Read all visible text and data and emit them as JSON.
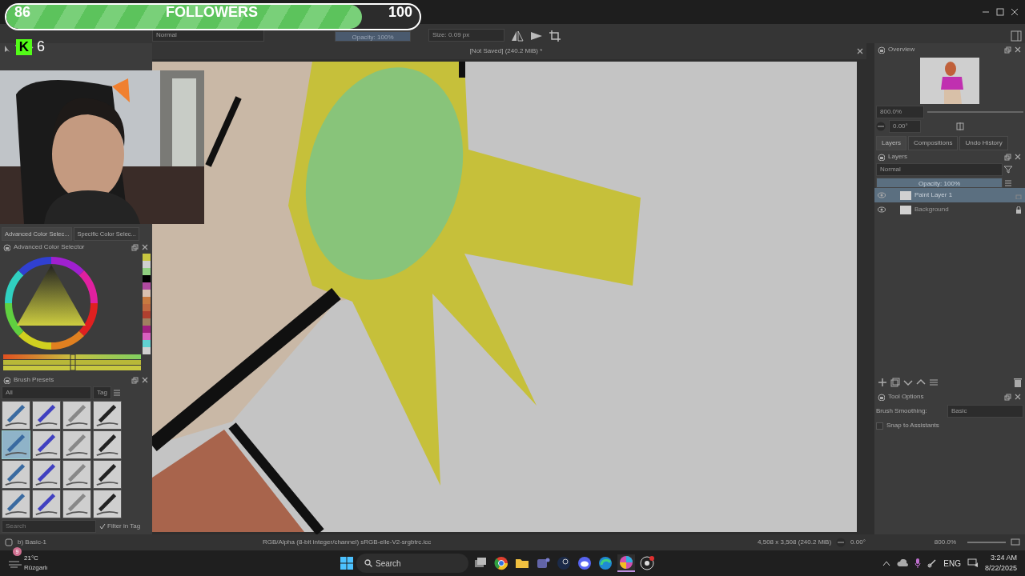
{
  "stream_overlay": {
    "followers_current": "86",
    "followers_label": "FOLLOWERS",
    "followers_goal": "100",
    "level": 0.86,
    "kick_logo": "K",
    "kick_count": "6"
  },
  "toolbar": {
    "blend_mode": "Normal",
    "opacity": {
      "label": "Opacity: 100%",
      "level": 1
    },
    "size": "Size: 0.09 px"
  },
  "document": {
    "title": "[Not Saved]  (240.2 MiB) *"
  },
  "color_panel": {
    "tabs": [
      {
        "label": "Advanced Color Selec...",
        "selected": true
      },
      {
        "label": "Specific Color Selec...",
        "selected": false
      }
    ],
    "title": "Advanced Color Selector",
    "swatches": [
      {
        "color": "#c8c640"
      },
      {
        "color": "#cfcfcf"
      },
      {
        "color": "#8fcf7f"
      },
      {
        "color": "#000000"
      },
      {
        "color": "#b04aa0"
      },
      {
        "color": "#d8c0b0"
      },
      {
        "color": "#c87a40"
      },
      {
        "color": "#c0683f"
      },
      {
        "color": "#b0402f"
      },
      {
        "color": "#a08060"
      },
      {
        "color": "#a02080"
      },
      {
        "color": "#d860c0"
      },
      {
        "color": "#60d0d0"
      },
      {
        "color": "#d0d0d0"
      }
    ]
  },
  "brush_presets": {
    "title": "Brush Presets",
    "filter": "All",
    "tag": "Tag",
    "search_placeholder": "Search",
    "filter_in_tag": {
      "label": "Filter in Tag",
      "checked": true
    },
    "presets": [
      {
        "selected": false
      },
      {
        "selected": false
      },
      {
        "selected": false
      },
      {
        "selected": false
      },
      {
        "selected": true
      },
      {
        "selected": false
      },
      {
        "selected": false
      },
      {
        "selected": false
      },
      {
        "selected": false
      },
      {
        "selected": false
      },
      {
        "selected": false
      },
      {
        "selected": false
      },
      {
        "selected": false
      },
      {
        "selected": false
      },
      {
        "selected": false
      },
      {
        "selected": false
      }
    ]
  },
  "overview": {
    "title": "Overview",
    "zoom": "800.0%",
    "rotation": "0.00°"
  },
  "docker_tabs": [
    {
      "label": "Layers",
      "selected": true
    },
    {
      "label": "Compositions",
      "selected": false
    },
    {
      "label": "Undo History",
      "selected": false
    }
  ],
  "layers": {
    "title": "Layers",
    "blend_mode": "Normal",
    "opacity": {
      "label": "Opacity:  100%",
      "level": 1
    },
    "items": [
      {
        "name": "Paint Layer 1",
        "selected": true,
        "visible": true,
        "locked": false
      },
      {
        "name": "Background",
        "selected": false,
        "visible": true,
        "locked": true
      }
    ]
  },
  "tool_options": {
    "title": "Tool Options",
    "smoothing_label": "Brush Smoothing:",
    "smoothing_value": "Basic",
    "snap": {
      "label": "Snap to Assistants",
      "checked": false
    }
  },
  "status_bar": {
    "preset": "b) Basic-1",
    "color_space": "RGB/Alpha (8-bit integer/channel)  sRGB-elle-V2-srgbtrc.icc",
    "dimensions": "4,508 x 3,508 (240.2 MiB)",
    "rotation": "0.00°",
    "zoom": "800.0%"
  },
  "taskbar": {
    "weather_badge": "9",
    "temperature": "21°C",
    "weather": "Rüzgarlı",
    "search": "Search",
    "apps": [
      {
        "kind": "files",
        "active": false
      },
      {
        "kind": "browser",
        "active": false
      },
      {
        "kind": "folder",
        "active": false
      },
      {
        "kind": "teams",
        "active": false
      },
      {
        "kind": "steam",
        "active": false
      },
      {
        "kind": "chat",
        "active": false
      },
      {
        "kind": "edge",
        "active": false
      },
      {
        "kind": "paint",
        "active": true
      },
      {
        "kind": "record",
        "active": false
      }
    ],
    "language": "ENG",
    "time": "3:24 AM",
    "date": "8/22/2025"
  }
}
